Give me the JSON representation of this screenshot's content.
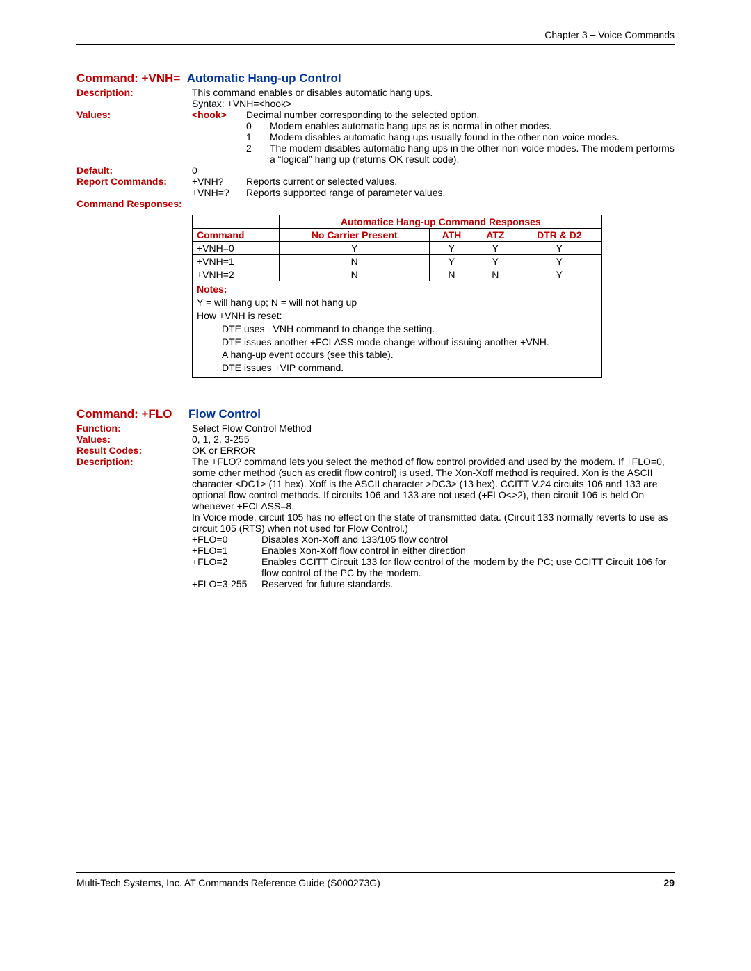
{
  "header": {
    "chapter": "Chapter 3 – Voice Commands"
  },
  "cmd1": {
    "title_cmd": "Command:  +VNH=",
    "title_name": "Automatic Hang-up Control",
    "desc_label": "Description:",
    "desc_line1": "This command enables or disables automatic hang ups.",
    "desc_line2": "Syntax: +VNH=<hook>",
    "values_label": "Values:",
    "hook_label": "<hook>",
    "hook_desc": "Decimal number corresponding to the selected option.",
    "opts": [
      {
        "n": "0",
        "t": "Modem enables automatic hang ups as is normal in other modes."
      },
      {
        "n": "1",
        "t": "Modem disables automatic hang ups usually found in the other non-voice modes."
      },
      {
        "n": "2",
        "t": "The modem disables automatic hang ups in the other non-voice modes. The modem performs a “logical” hang up (returns OK result code)."
      }
    ],
    "default_label": "Default:",
    "default_val": "0",
    "report_label": "Report Commands:",
    "report_rows": [
      {
        "k": "+VNH?",
        "t": "Reports current or selected values."
      },
      {
        "k": "+VNH=?",
        "t": "Reports supported range of parameter values."
      }
    ],
    "resp_label": "Command Responses:",
    "table": {
      "caption": "Automatice Hang-up Command Responses",
      "headers": [
        "Command",
        "No Carrier Present",
        "ATH",
        "ATZ",
        "DTR & D2"
      ],
      "rows": [
        [
          "+VNH=0",
          "Y",
          "Y",
          "Y",
          "Y"
        ],
        [
          "+VNH=1",
          "N",
          "Y",
          "Y",
          "Y"
        ],
        [
          "+VNH=2",
          "N",
          "N",
          "N",
          "Y"
        ]
      ],
      "notes_label": "Notes:",
      "notes": [
        "Y = will hang up; N = will not hang up",
        "How +VNH is reset:",
        "DTE uses +VNH command to change the setting.",
        "DTE issues another +FCLASS mode change without issuing another +VNH.",
        "A hang-up event occurs (see this table).",
        "DTE issues +VIP command."
      ]
    }
  },
  "cmd2": {
    "title_cmd": "Command:  +FLO",
    "title_name": "Flow Control",
    "function_label": "Function:",
    "function_val": "Select Flow Control Method",
    "values_label": "Values:",
    "values_val": "0, 1, 2, 3-255",
    "result_label": "Result Codes:",
    "result_val": "OK or ERROR",
    "desc_label": "Description:",
    "desc_para1": "The +FLO? command lets you select the method of flow control provided and used by the modem. If +FLO=0, some other method (such as credit flow control) is used. The Xon-Xoff method is required. Xon is the ASCII character <DC1> (11 hex). Xoff is the ASCII character >DC3> (13 hex). CCITT V.24 circuits 106 and 133 are optional flow control methods. If circuits 106 and 133 are not used (+FLO<>2), then circuit 106 is held On whenever +FCLASS=8.",
    "desc_para2": "In Voice mode, circuit 105 has no effect on the state of transmitted data. (Circuit 133 normally reverts to use as circuit 105 (RTS) when not used for Flow Control.)",
    "opts": [
      {
        "k": "+FLO=0",
        "t": "Disables Xon-Xoff and 133/105 flow control"
      },
      {
        "k": "+FLO=1",
        "t": "Enables Xon-Xoff flow control in either direction"
      },
      {
        "k": "+FLO=2",
        "t": "Enables CCITT Circuit 133 for flow control of the modem by the PC; use CCITT Circuit 106 for flow control of the PC by the modem."
      },
      {
        "k": "+FLO=3-255",
        "t": "Reserved for future standards."
      }
    ]
  },
  "footer": {
    "text": "Multi-Tech Systems, Inc. AT Commands Reference Guide (S000273G)",
    "page": "29"
  }
}
